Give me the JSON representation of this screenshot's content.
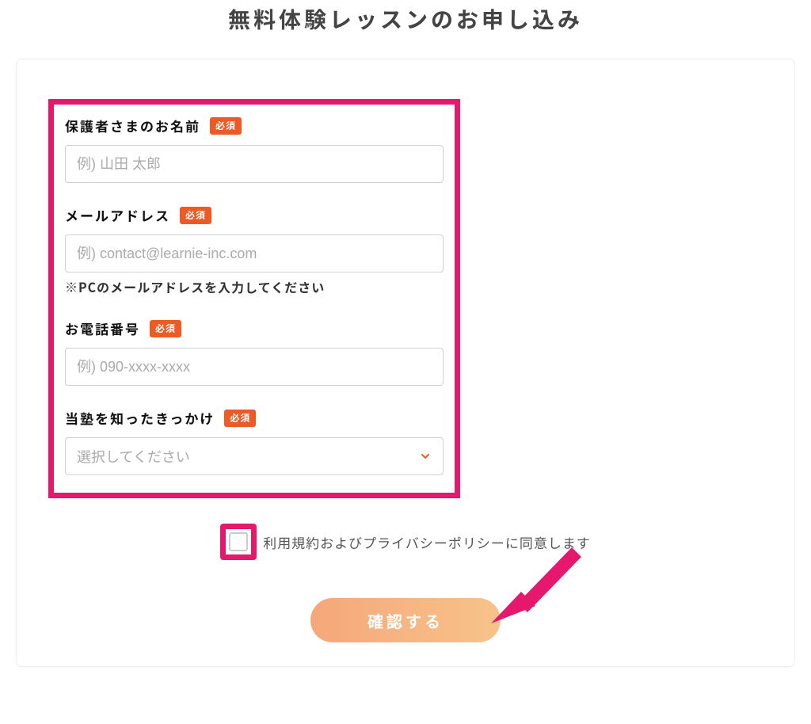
{
  "page": {
    "title": "無料体験レッスンのお申し込み"
  },
  "form": {
    "required_label": "必須",
    "fields": {
      "guardian_name": {
        "label": "保護者さまのお名前",
        "placeholder": "例) 山田 太郎"
      },
      "email": {
        "label": "メールアドレス",
        "placeholder": "例) contact@learnie-inc.com",
        "note": "※PCのメールアドレスを入力してください"
      },
      "phone": {
        "label": "お電話番号",
        "placeholder": "例) 090-xxxx-xxxx"
      },
      "referral": {
        "label": "当塾を知ったきっかけ",
        "placeholder": "選択してください"
      }
    },
    "consent": {
      "text": "利用規約およびプライバシーポリシーに同意します"
    },
    "submit": {
      "label": "確認する"
    }
  }
}
